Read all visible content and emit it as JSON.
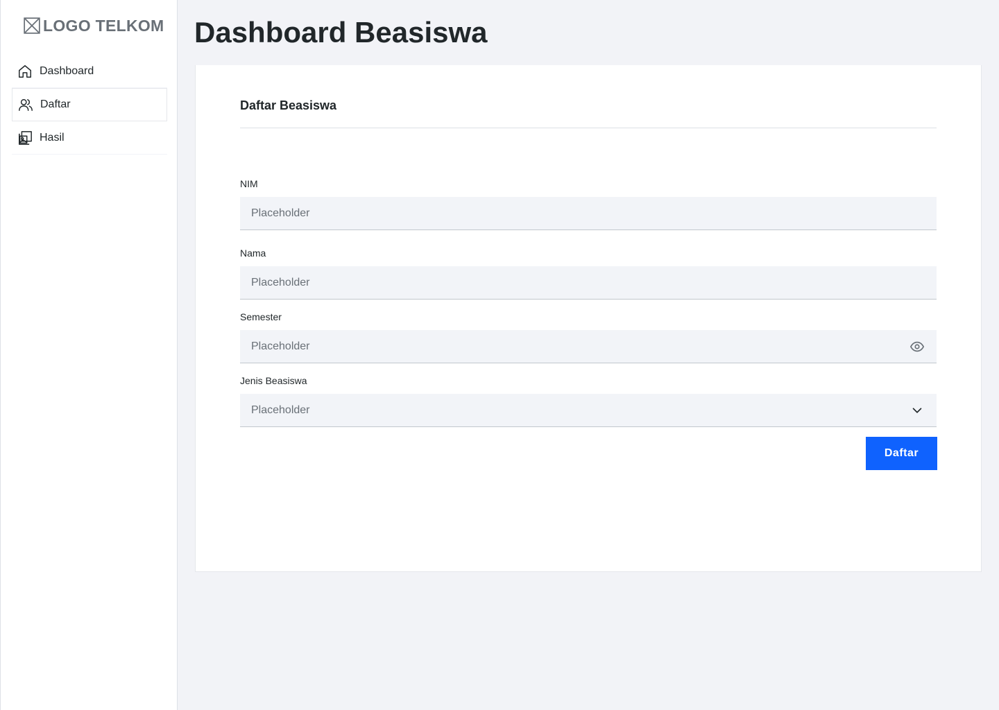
{
  "sidebar": {
    "logo_text": "LOGO TELKOM",
    "items": [
      {
        "label": "Dashboard",
        "icon": "home-icon"
      },
      {
        "label": "Daftar",
        "icon": "users-icon"
      },
      {
        "label": "Hasil",
        "icon": "gallery-icon"
      }
    ],
    "active_item": "Daftar"
  },
  "page": {
    "title": "Dashboard Beasiswa"
  },
  "form": {
    "title": "Daftar Beasiswa",
    "fields": [
      {
        "label": "NIM",
        "placeholder": "Placeholder",
        "value": ""
      },
      {
        "label": "Nama",
        "placeholder": "Placeholder",
        "value": ""
      },
      {
        "label": "Semester",
        "placeholder": "Placeholder",
        "value": "",
        "trailing_icon": "eye-icon"
      },
      {
        "label": "Jenis Beasiswa",
        "placeholder": "Placeholder",
        "value": "",
        "trailing_icon": "chevron-down-icon"
      }
    ],
    "submit_label": "Daftar"
  },
  "colors": {
    "primary": "#0f62fe",
    "text": "#21272a",
    "muted": "#697077",
    "field_bg": "#f2f4f8",
    "page_bg": "#f2f3f7"
  }
}
